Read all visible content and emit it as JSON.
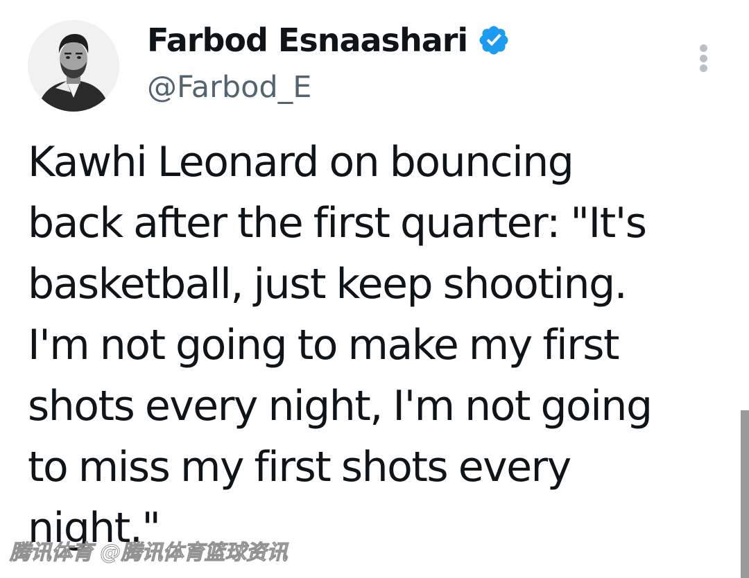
{
  "tweet": {
    "author": {
      "display_name": "Farbod Esnaashari",
      "handle": "@Farbod_E",
      "verified": true,
      "verified_color": "#1d9bf0"
    },
    "text_lines": [
      "Kawhi Leonard on bouncing",
      "back after the first quarter: \"It's",
      "basketball, just keep shooting.",
      "I'm not going to make my first",
      "shots every night, I'm not going",
      "to miss my first shots every",
      "night.\""
    ]
  },
  "watermark": {
    "text": "腾讯体育 @腾讯体育篮球资讯"
  },
  "icons": {
    "more": "more-vertical-icon",
    "verified": "verified-badge-icon"
  }
}
